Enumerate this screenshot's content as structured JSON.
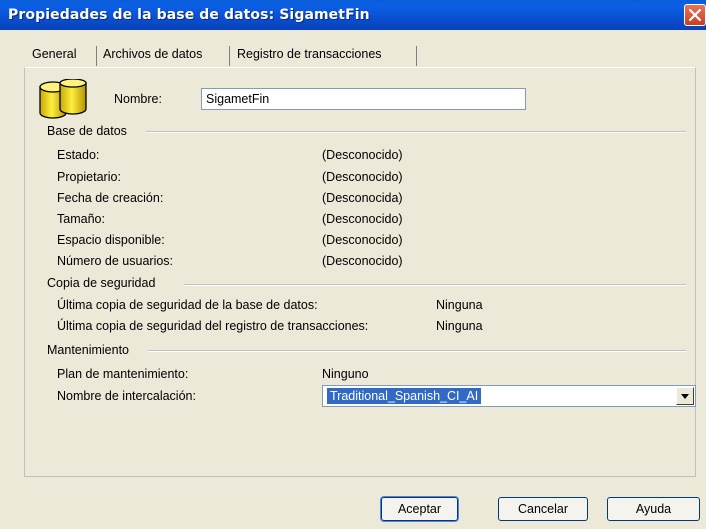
{
  "window": {
    "title": "Propiedades de la base de datos: SigametFin"
  },
  "tabs": [
    "General",
    "Archivos de datos",
    "Registro de transacciones"
  ],
  "general": {
    "name_label": "Nombre:",
    "name_value": "SigametFin",
    "database_section": "Base de datos",
    "database_rows": [
      {
        "label": "Estado:",
        "value": "(Desconocido)"
      },
      {
        "label": "Propietario:",
        "value": "(Desconocido)"
      },
      {
        "label": "Fecha de creación:",
        "value": "(Desconocida)"
      },
      {
        "label": "Tamaño:",
        "value": "(Desconocido)"
      },
      {
        "label": "Espacio disponible:",
        "value": "(Desconocido)"
      },
      {
        "label": "Número de usuarios:",
        "value": "(Desconocido)"
      }
    ],
    "backup_section": "Copia de seguridad",
    "backup_rows": [
      {
        "label": "Última copia de seguridad de la base de datos:",
        "value": "Ninguna"
      },
      {
        "label": "Última copia de seguridad del registro de transacciones:",
        "value": "Ninguna"
      }
    ],
    "maintenance_section": "Mantenimiento",
    "maintenance_plan_label": "Plan de mantenimiento:",
    "maintenance_plan_value": "Ninguno",
    "collation_label": "Nombre de intercalación:",
    "collation_value": "Traditional_Spanish_CI_AI"
  },
  "buttons": {
    "ok": "Aceptar",
    "cancel": "Cancelar",
    "help": "Ayuda"
  }
}
